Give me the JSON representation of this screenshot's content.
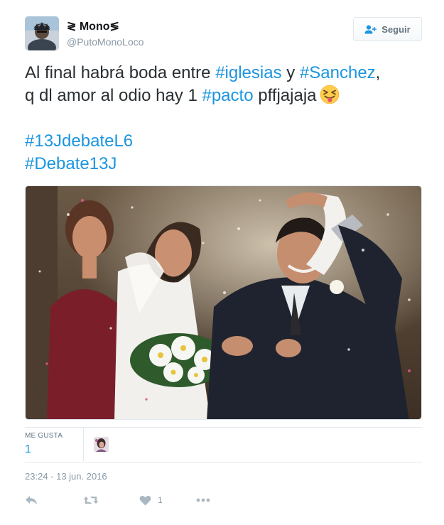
{
  "user": {
    "display_name": "≷ Mono≶",
    "screen_name": "@PutoMonoLoco"
  },
  "follow_button": {
    "label": "Seguir",
    "icon": "add-user-icon"
  },
  "tweet": {
    "line1_pre": "Al final habrá boda entre ",
    "hashtag1": "#iglesias",
    "line1_mid": " y ",
    "hashtag2": "#Sanchez",
    "line1_post": ",",
    "line2_pre": "q dl amor al odio hay 1 ",
    "hashtag3": "#pacto",
    "line2_post": " pffjajaja",
    "emoji": "squinting-face-with-tongue",
    "hashtag4": "#13JdebateL6",
    "hashtag5": "#Debate13J"
  },
  "stats": {
    "likes_label": "ME GUSTA",
    "likes_count": "1"
  },
  "timestamp": "23:24 - 13 jun. 2016",
  "actions": {
    "reply_icon": "reply-icon",
    "retweet_icon": "retweet-icon",
    "like_icon": "heart-icon",
    "like_count": "1",
    "more_icon": "more-icon"
  },
  "colors": {
    "hashtag": "#1b95e0",
    "text": "#292f33",
    "muted": "#8899a6",
    "action": "#aab8c2",
    "border": "#e1e8ed"
  }
}
